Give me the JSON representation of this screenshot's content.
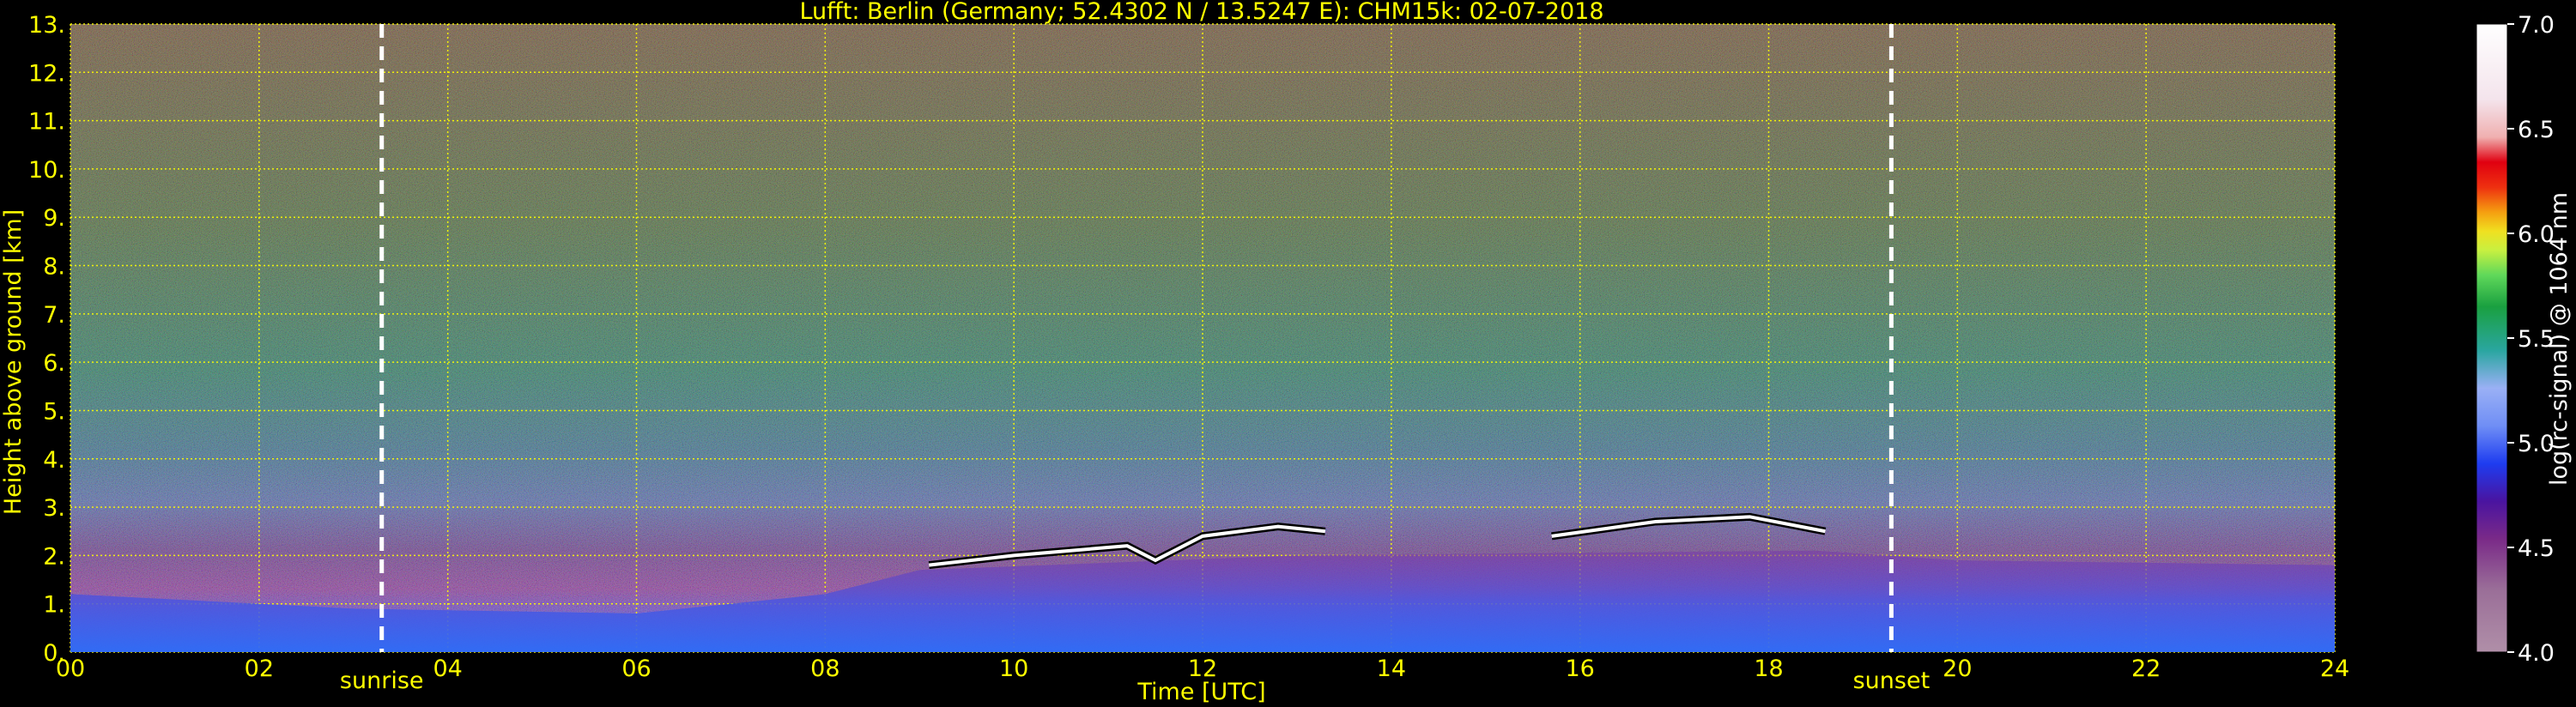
{
  "chart_data": {
    "type": "heatmap",
    "title": "Lufft: Berlin (Germany; 52.4302 N / 13.5247 E):    CHM15k: 02-07-2018",
    "xlabel": "Time [UTC]",
    "ylabel": "Height above ground [km]",
    "x_ticks": [
      "00",
      "02",
      "04",
      "06",
      "08",
      "10",
      "12",
      "14",
      "16",
      "18",
      "20",
      "22",
      "24"
    ],
    "y_ticks": [
      "0.",
      "1.",
      "2.",
      "3.",
      "4.",
      "5.",
      "6.",
      "7.",
      "8.",
      "9.",
      "10.",
      "11.",
      "12.",
      "13."
    ],
    "xlim": [
      0,
      24
    ],
    "ylim": [
      0,
      13
    ],
    "grid": true,
    "annotations": [
      {
        "text": "sunrise",
        "x": 3.3
      },
      {
        "text": "sunset",
        "x": 19.3
      }
    ],
    "colorbar": {
      "label": "log(rc-signal) @ 1064 nm",
      "range": [
        4.0,
        7.0
      ],
      "ticks": [
        "7.0",
        "6.5",
        "6.0",
        "5.5",
        "5.0",
        "4.5",
        "4.0"
      ]
    },
    "features": {
      "cloud_layer_top_km": [
        {
          "x": 9.1,
          "y": 1.8
        },
        {
          "x": 10.0,
          "y": 2.0
        },
        {
          "x": 11.2,
          "y": 2.2
        },
        {
          "x": 11.5,
          "y": 1.9
        },
        {
          "x": 12.0,
          "y": 2.4
        },
        {
          "x": 12.8,
          "y": 2.6
        },
        {
          "x": 13.3,
          "y": 2.5
        },
        {
          "x": 15.7,
          "y": 2.4
        },
        {
          "x": 16.8,
          "y": 2.7
        },
        {
          "x": 17.8,
          "y": 2.8
        },
        {
          "x": 18.6,
          "y": 2.5
        }
      ],
      "boundary_layer_top_km": [
        {
          "x": 0,
          "y": 1.2
        },
        {
          "x": 3,
          "y": 0.9
        },
        {
          "x": 6,
          "y": 0.8
        },
        {
          "x": 8,
          "y": 1.2
        },
        {
          "x": 9,
          "y": 1.7
        },
        {
          "x": 13,
          "y": 2.0
        },
        {
          "x": 18.5,
          "y": 2.1
        },
        {
          "x": 20,
          "y": 1.9
        },
        {
          "x": 24,
          "y": 1.8
        }
      ]
    },
    "colors": {
      "axis_text": "#ffff00",
      "grid": "#ffff00",
      "background": "#000000",
      "sun_lines": "#ffffff"
    }
  }
}
